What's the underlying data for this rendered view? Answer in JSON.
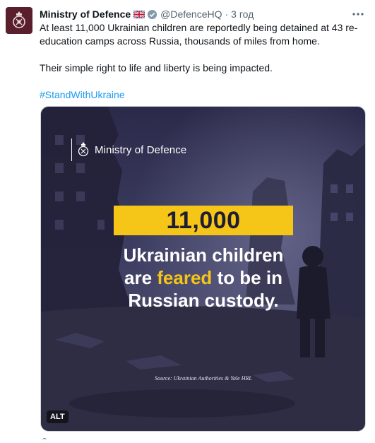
{
  "tweet": {
    "author_name": "Ministry of Defence",
    "handle": "@DefenceHQ",
    "separator": "·",
    "time": "3 год",
    "paragraph1": "At least 11,000 Ukrainian children are reportedly being detained at 43 re-education camps across Russia, thousands of miles from home.",
    "paragraph2": "Their simple right to life and liberty is being impacted.",
    "hashtag": "#StandWithUkraine",
    "more_icon": "more-horizontal-icon",
    "verified_icon": "verified-badge-icon",
    "flag_icon": "uk-flag-icon"
  },
  "media": {
    "logo_text": "Ministry of Defence",
    "stat": "11,000",
    "headline_line1": "Ukrainian children",
    "headline_line2_before": "are ",
    "headline_line2_highlight": "feared",
    "headline_line2_after": " to be in",
    "headline_line3": "Russian custody.",
    "source": "Source: Ukrainian Authorities & Yale HRL",
    "alt_label": "ALT"
  },
  "colors": {
    "accent_yellow": "#f5c518",
    "link_blue": "#1d9bf0",
    "avatar_bg": "#5a1f2c",
    "text": "#0f1419",
    "muted": "#536471"
  }
}
